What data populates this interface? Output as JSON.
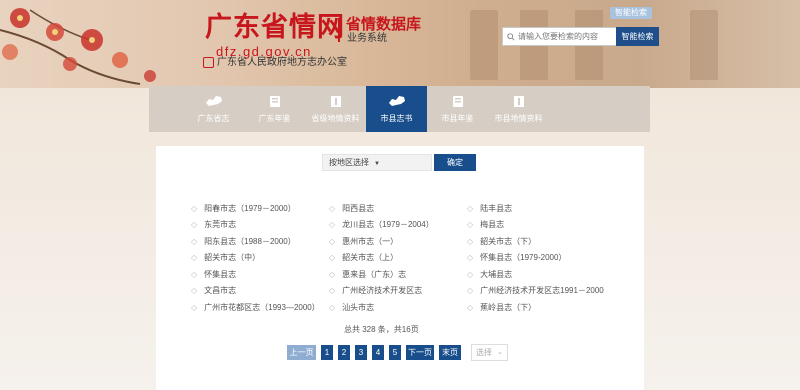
{
  "header": {
    "logo_main": "广东省情网",
    "logo_db": "省情数据库",
    "logo_sys": "业务系统",
    "logo_url": "dfz.gd.gov.cn",
    "logo_office": "广东省人民政府地方志办公室",
    "top_link": "智能检索",
    "search_placeholder": "请输入您要检索的内容",
    "search_button": "智能检索"
  },
  "nav": {
    "items": [
      {
        "label": "广东省志",
        "icon": "map-icon",
        "active": false
      },
      {
        "label": "广东年鉴",
        "icon": "book-icon",
        "active": false
      },
      {
        "label": "省级地情资料",
        "icon": "document-icon",
        "active": false
      },
      {
        "label": "市县志书",
        "icon": "map-icon",
        "active": true
      },
      {
        "label": "市县年鉴",
        "icon": "book-icon",
        "active": false
      },
      {
        "label": "市县地情资料",
        "icon": "document-icon",
        "active": false
      }
    ]
  },
  "filter": {
    "select_value": "按地区选择",
    "confirm_label": "确定"
  },
  "books": {
    "col1": [
      "阳春市志（1979－2000）",
      "东莞市志",
      "阳东县志（1988－2000）",
      "韶关市志（中）",
      "怀集县志",
      "文昌市志",
      "广州市花都区志（1993—2000）"
    ],
    "col2": [
      "阳西县志",
      "龙川县志（1979－2004）",
      "惠州市志（一）",
      "韶关市志（上）",
      "惠来县（广东）志",
      "广州经济技术开发区志",
      "汕头市志"
    ],
    "col3": [
      "陆丰县志",
      "梅县志",
      "韶关市志（下）",
      "怀集县志（1979-2000）",
      "大埔县志",
      "广州经济技术开发区志1991－2000",
      "蕉岭县志（下）"
    ]
  },
  "pagination": {
    "total_text": "总共 328 条，共16页",
    "prev": "上一页",
    "pages": [
      "1",
      "2",
      "3",
      "4",
      "5"
    ],
    "next": "下一页",
    "last": "末页",
    "jump_placeholder": "选择"
  },
  "colors": {
    "accent": "#184e8b",
    "logo_red": "#c8161d",
    "nav_bg": "#d6cec5"
  }
}
